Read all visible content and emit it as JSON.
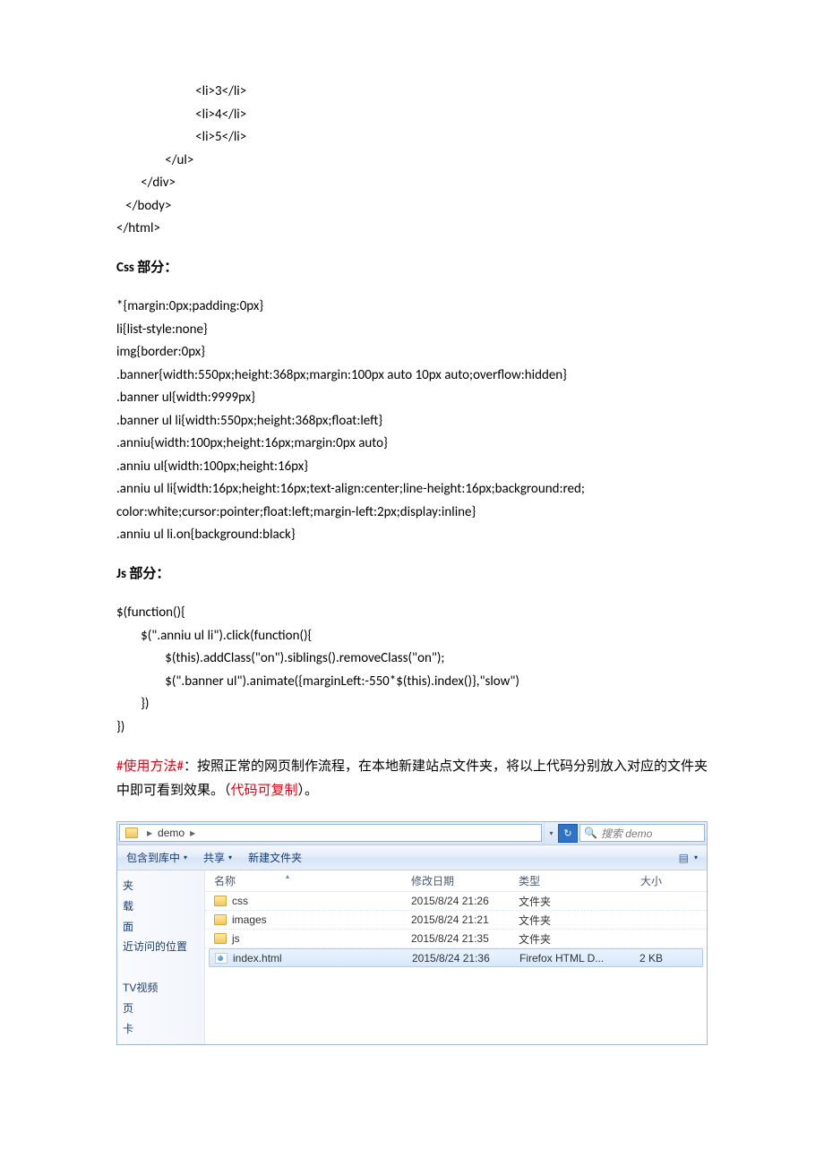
{
  "code_html": "                          <li>3</li>\n                          <li>4</li>\n                          <li>5</li>\n                </ul>\n        </div>\n   </body>\n</html>",
  "section_css": "Css 部分：",
  "code_css": "*{margin:0px;padding:0px}\nli{list-style:none}\nimg{border:0px}\n.banner{width:550px;height:368px;margin:100px auto 10px auto;overflow:hidden}\n.banner ul{width:9999px}\n.banner ul li{width:550px;height:368px;float:left}\n.anniu{width:100px;height:16px;margin:0px auto}\n.anniu ul{width:100px;height:16px}\n.anniu ul li{width:16px;height:16px;text-align:center;line-height:16px;background:red;\ncolor:white;cursor:pointer;float:left;margin-left:2px;display:inline}\n.anniu ul li.on{background:black}",
  "section_js": "Js 部分：",
  "code_js": "$(function(){\n        $(\".anniu ul li\").click(function(){\n                $(this).addClass(\"on\").siblings().removeClass(\"on\");\n                $(\".banner ul\").animate({marginLeft:-550*$(this).index()},\"slow\")\n        })\n})",
  "usage": {
    "tag": "#使用方法#",
    "colon": "：",
    "text1": "按照正常的网页制作流程，在本地新建站点文件夹，将以上代码分别放入对应的文件夹中即可看到效果。（",
    "text2": "代码可复制",
    "text3": "）。"
  },
  "explorer": {
    "crumb": "demo",
    "search": "搜索 demo",
    "toolbar": {
      "include": "包含到库中",
      "share": "共享",
      "newfolder": "新建文件夹",
      "view": "▤"
    },
    "nav": [
      "夹",
      "载",
      "面",
      "近访问的位置",
      "",
      "TV视频",
      "页",
      "卡"
    ],
    "headers": {
      "name": "名称",
      "date": "修改日期",
      "type": "类型",
      "size": "大小"
    },
    "rows": [
      {
        "name": "css",
        "date": "2015/8/24 21:26",
        "type": "文件夹",
        "size": "",
        "icon": "folder"
      },
      {
        "name": "images",
        "date": "2015/8/24 21:21",
        "type": "文件夹",
        "size": "",
        "icon": "folder"
      },
      {
        "name": "js",
        "date": "2015/8/24 21:35",
        "type": "文件夹",
        "size": "",
        "icon": "folder"
      },
      {
        "name": "index.html",
        "date": "2015/8/24 21:36",
        "type": "Firefox HTML D...",
        "size": "2 KB",
        "icon": "html",
        "sel": true
      }
    ]
  }
}
